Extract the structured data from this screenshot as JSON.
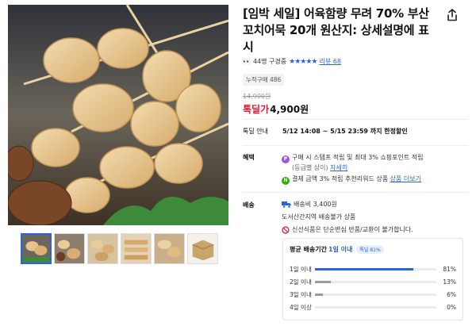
{
  "product": {
    "title": "[임박 세일] 어육함량 무려 70% 부산 꼬치어묵 20개 원산지: 상세설명에 표시",
    "review_count_text": "44명 구경중",
    "stars": "★★★★★",
    "review_link": "리뷰 68",
    "sold_badge": "누적구매 486",
    "original_price": "14,900원",
    "sale_label": "톡딜가",
    "sale_price": "4,900원",
    "share_icon": "share-icon"
  },
  "notice": {
    "label": "톡딜 안내",
    "period": "5/12 14:08 ~ 5/15 23:59 까지 한정할인"
  },
  "benefits": {
    "label": "혜택",
    "line1": "구매 시 스탬프 적립 및 최대 3% 쇼핑포인트 적립",
    "line1_sub": "(등급별 상이)",
    "line1_link": "자세히",
    "line2": "결제 금액 3% 적립 추천리워드 상품",
    "line2_link": "상품 더보기"
  },
  "shipping": {
    "label": "배송",
    "fee": "배송비 3,400원",
    "restriction": "도서산간지역 배송불가 상품",
    "fresh_notice": "신선식품은 단순변심 반품/교환이 불가합니다."
  },
  "delivery": {
    "title_prefix": "평균 배송기간",
    "title_highlight": "1일 이내",
    "badge": "톡딜 81%",
    "rows": [
      {
        "label": "1일 이내",
        "value": 81,
        "pct": "81%"
      },
      {
        "label": "2일 이내",
        "value": 13,
        "pct": "13%"
      },
      {
        "label": "3일 이내",
        "value": 6,
        "pct": "6%"
      },
      {
        "label": "4일 이상",
        "value": 0,
        "pct": "0%"
      }
    ]
  },
  "colors": {
    "accent": "#2a64d6",
    "sale": "#e1162c"
  }
}
